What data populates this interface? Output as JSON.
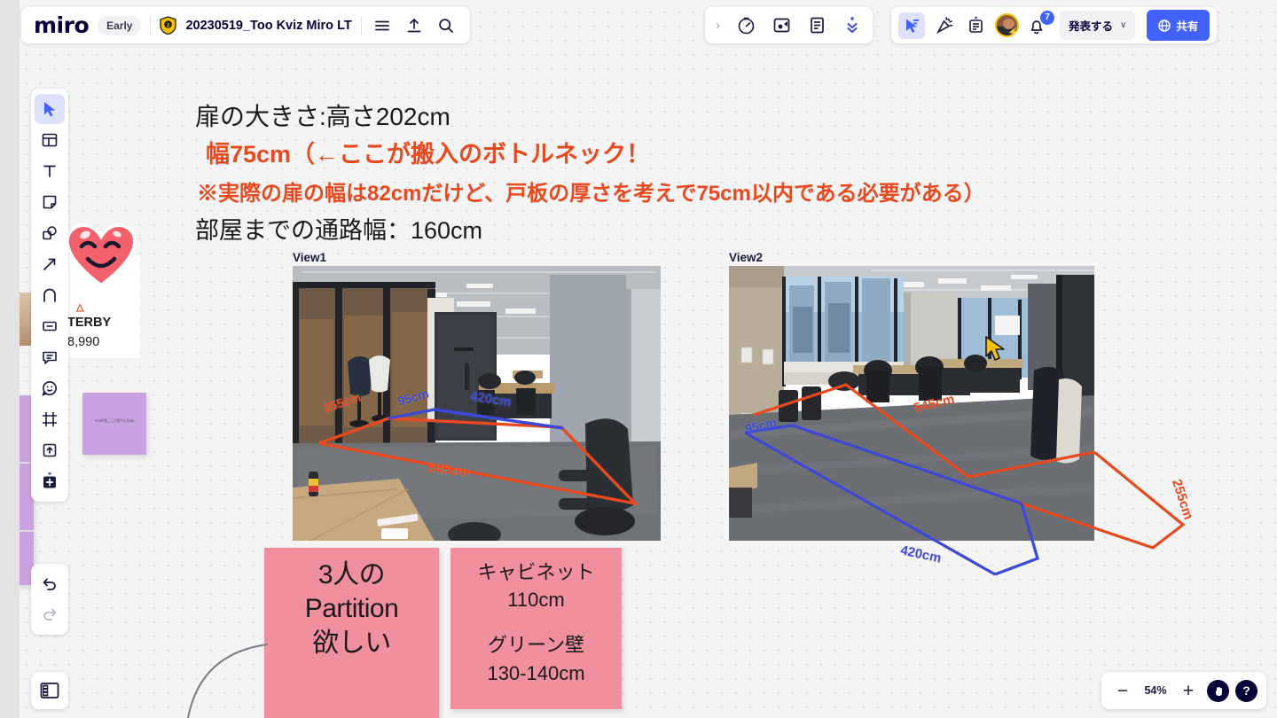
{
  "app": {
    "logo": "miro",
    "early_chip": "Early",
    "board_title": "20230519_Too Kviz Miro LT",
    "shield_badge": "2"
  },
  "topbar": {
    "menu_icon": "hamburger-menu-icon",
    "upload_icon": "upload-icon",
    "search_icon": "search-icon"
  },
  "top_tools": {
    "expand_label": "›",
    "timer_icon": "timer-icon",
    "video_chat_icon": "video-chat-icon",
    "notes_icon": "notes-icon",
    "more_icon": "chevrons-down-icon"
  },
  "top_actions": {
    "cursor_icon": "cursor-share-icon",
    "celebrate_icon": "celebration-icon",
    "comment_icon": "comment-panel-icon",
    "avatar_name": "user-avatar",
    "bell_icon": "notifications-bell-icon",
    "notification_count": "7",
    "present_label": "発表する",
    "present_caret": "∨",
    "share_label": "共有",
    "share_icon": "globe-icon"
  },
  "left_toolbar": {
    "items": [
      {
        "name": "select-tool",
        "icon": "cursor-arrow-icon",
        "selected": true
      },
      {
        "name": "templates-tool",
        "icon": "templates-icon",
        "selected": false
      },
      {
        "name": "text-tool",
        "icon": "text-T-icon",
        "selected": false
      },
      {
        "name": "sticky-note-tool",
        "icon": "sticky-note-icon",
        "selected": false
      },
      {
        "name": "shapes-tool",
        "icon": "shapes-icon",
        "selected": false
      },
      {
        "name": "connector-tool",
        "icon": "arrow-line-icon",
        "selected": false
      },
      {
        "name": "pen-tool",
        "icon": "pen-draw-icon",
        "selected": false
      },
      {
        "name": "frame-card-tool",
        "icon": "card-icon",
        "selected": false
      },
      {
        "name": "comment-tool",
        "icon": "comment-bubble-icon",
        "selected": false
      },
      {
        "name": "reaction-tool",
        "icon": "emoji-sticker-icon",
        "selected": false
      },
      {
        "name": "frame-tool",
        "icon": "frame-icon",
        "selected": false
      },
      {
        "name": "upload-tool",
        "icon": "upload-box-icon",
        "selected": false
      },
      {
        "name": "more-apps-tool",
        "icon": "plus-apps-icon",
        "selected": false
      }
    ],
    "undo_icon": "undo-arrow-icon",
    "redo_icon": "redo-arrow-icon",
    "panel_icon": "side-panel-icon"
  },
  "zoom_controls": {
    "minus_label": "−",
    "value": "54%",
    "plus_label": "+",
    "hand_icon": "hand-pointer-icon",
    "help_label": "?"
  },
  "board": {
    "headline_door": "扉の大きさ:高さ20 2cm",
    "texts": {
      "door_size": "扉の大きさ:高さ202cm",
      "width_bottleneck": "幅75cm（←ここが搬入のボトルネック！",
      "actual_width_note": "※実際の扉の幅は82cmだけど、戸板の厚さを考えで75cm以内である必要がある）",
      "corridor_width": "部屋までの通路幅：160cm"
    },
    "view1": {
      "label": "View1",
      "measurements": [
        {
          "value": "255cm",
          "color": "red"
        },
        {
          "value": "95cm",
          "color": "blue"
        },
        {
          "value": "420cm",
          "color": "blue"
        },
        {
          "value": "545cm",
          "color": "red"
        }
      ]
    },
    "view2": {
      "label": "View2",
      "measurements": [
        {
          "value": "95cm",
          "color": "blue"
        },
        {
          "value": "545cm",
          "color": "red"
        },
        {
          "value": "420cm",
          "color": "blue"
        },
        {
          "value": "255cm",
          "color": "red"
        }
      ]
    },
    "sticky_notes": [
      {
        "name": "sticky-note-partition",
        "lines": [
          "3人の",
          "Partition",
          "欲しい"
        ],
        "color": "#f0909f"
      },
      {
        "name": "sticky-note-cabinet",
        "lines": [
          "キャビネット",
          "110cm",
          "グリーン壁",
          "130-140cm"
        ],
        "color": "#f0909f"
      }
    ],
    "product_card": {
      "brand_mark": "△",
      "name": "TERBY",
      "price": "8,990"
    },
    "purple_note_text": "sofaの色ここに貼りんだigo",
    "heart_sticker": "heart-smiling-sticker"
  },
  "colors": {
    "accent_blue": "#4262ff",
    "measure_red": "#e8491f",
    "measure_blue": "#3b49d6",
    "sticky_pink": "#f0909f",
    "sticky_purple": "#c9a3e0",
    "canvas": "#f4f4f4"
  }
}
